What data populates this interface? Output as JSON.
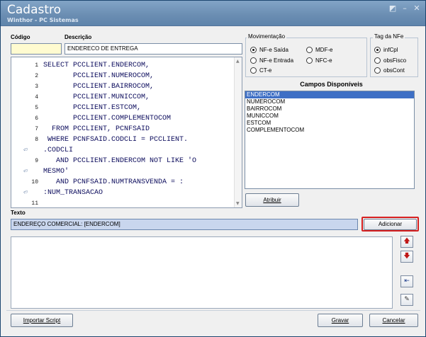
{
  "window": {
    "title": "Cadastro",
    "subtitle": "Winthor - PC Sistemas"
  },
  "form": {
    "codigo_label": "Código",
    "codigo_value": "",
    "descricao_label": "Descrição",
    "descricao_value": "ENDERECO DE ENTREGA"
  },
  "sql_editor": {
    "lines": [
      {
        "num": "1",
        "text": "SELECT PCCLIENT.ENDERCOM,"
      },
      {
        "num": "2",
        "text": "       PCCLIENT.NUMEROCOM,"
      },
      {
        "num": "3",
        "text": "       PCCLIENT.BAIRROCOM,"
      },
      {
        "num": "4",
        "text": "       PCCLIENT.MUNICCOM,"
      },
      {
        "num": "5",
        "text": "       PCCLIENT.ESTCOM,"
      },
      {
        "num": "6",
        "text": "       PCCLIENT.COMPLEMENTOCOM"
      },
      {
        "num": "7",
        "text": "  FROM PCCLIENT, PCNFSAID"
      },
      {
        "num": "8",
        "text": " WHERE PCNFSAID.CODCLI = PCCLIENT."
      },
      {
        "num": "",
        "text": ".CODCLI"
      },
      {
        "num": "9",
        "text": "   AND PCCLIENT.ENDERCOM NOT LIKE 'O"
      },
      {
        "num": "",
        "text": "MESMO'"
      },
      {
        "num": "10",
        "text": "   AND PCNFSAID.NUMTRANSVENDA = :"
      },
      {
        "num": "",
        "text": ":NUM_TRANSACAO"
      },
      {
        "num": "11",
        "text": ""
      }
    ]
  },
  "movimentacao": {
    "title": "Movimentação",
    "options": [
      "NF-e Saída",
      "MDF-e",
      "NF-e Entrada",
      "NFC-e",
      "CT-e"
    ],
    "selected": "NF-e Saída"
  },
  "tag_nfe": {
    "title": "Tag da NFe",
    "options": [
      "infCpl",
      "obsFisco",
      "obsCont"
    ],
    "selected": "infCpl"
  },
  "campos": {
    "title": "Campos Disponíveis",
    "items": [
      "ENDERCOM",
      "NUMEROCOM",
      "BAIRROCOM",
      "MUNICCOM",
      "ESTCOM",
      "COMPLEMENTOCOM"
    ],
    "selected": "ENDERCOM"
  },
  "buttons": {
    "atribuir": "Atribuir",
    "adicionar": "Adicionar",
    "importar": "Importar Script",
    "gravar": "Gravar",
    "cancelar": "Cancelar"
  },
  "texto": {
    "label": "Texto",
    "value": "ENDEREÇO COMERCIAL: [ENDERCOM]"
  },
  "colors": {
    "accent_red": "#d62020",
    "selection": "#3e6fc5",
    "title_bar": "#6a8db2"
  },
  "icons": [
    "minimize-icon",
    "maximize-icon",
    "close-icon",
    "arrow-up-icon",
    "arrow-down-icon",
    "insert-field-icon",
    "clear-icon"
  ]
}
